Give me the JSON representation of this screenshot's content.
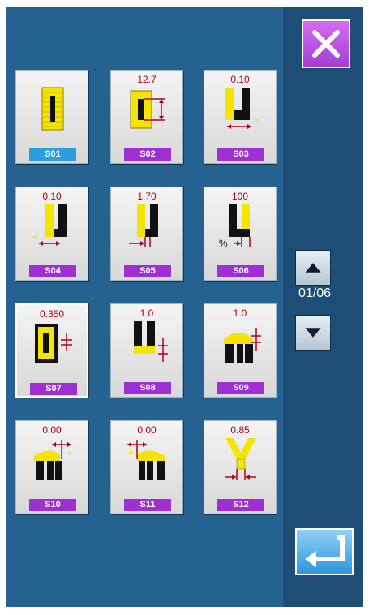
{
  "page": {
    "indicator": "01/06"
  },
  "colors": {
    "screen_bg": "#26628f",
    "sidebar_bg": "#1e4e75",
    "label_purple": "#9e2fd3",
    "label_active": "#2a9fe0",
    "stitch_yellow": "#f5e400",
    "value_red": "#b0001a"
  },
  "icons": {
    "close": "close-icon",
    "up": "up-arrow-icon",
    "down": "down-arrow-icon",
    "enter": "enter-icon"
  },
  "patterns": [
    {
      "label": "S01",
      "value": ""
    },
    {
      "label": "S02",
      "value": "12.7"
    },
    {
      "label": "S03",
      "value": "0.10"
    },
    {
      "label": "S04",
      "value": "0.10"
    },
    {
      "label": "S05",
      "value": "1.70"
    },
    {
      "label": "S06",
      "value": "100"
    },
    {
      "label": "S07",
      "value": "0.350"
    },
    {
      "label": "S08",
      "value": "1.0"
    },
    {
      "label": "S09",
      "value": "1.0"
    },
    {
      "label": "S10",
      "value": "0.00"
    },
    {
      "label": "S11",
      "value": "0.00"
    },
    {
      "label": "S12",
      "value": "0.85"
    }
  ],
  "icon_marks": {
    "percent": "%"
  }
}
